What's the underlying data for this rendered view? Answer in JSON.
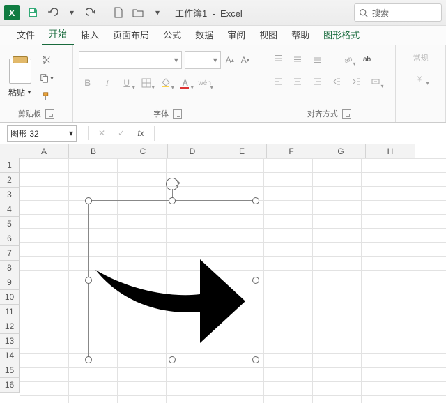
{
  "title": {
    "doc": "工作簿1",
    "app": "Excel"
  },
  "qat": {
    "save": "保存",
    "undo": "撤消",
    "redo": "恢复",
    "new": "新建",
    "open": "打开"
  },
  "search": {
    "placeholder": "搜索"
  },
  "tabs": {
    "file": "文件",
    "home": "开始",
    "insert": "插入",
    "layout": "页面布局",
    "formulas": "公式",
    "data": "数据",
    "review": "审阅",
    "view": "视图",
    "help": "帮助",
    "shape_format": "图形格式"
  },
  "ribbon": {
    "clipboard": {
      "label": "剪贴板",
      "paste": "粘贴"
    },
    "font": {
      "label": "字体",
      "bold": "B",
      "italic": "I",
      "underline": "U",
      "wen": "wén"
    },
    "align": {
      "label": "对齐方式",
      "wrap": "ab"
    },
    "general": {
      "label": "常规"
    }
  },
  "namebox": {
    "value": "图形 32"
  },
  "columns": [
    "A",
    "B",
    "C",
    "D",
    "E",
    "F",
    "G",
    "H"
  ],
  "rows": [
    "1",
    "2",
    "3",
    "4",
    "5",
    "6",
    "7",
    "8",
    "9",
    "10",
    "11",
    "12",
    "13",
    "14",
    "15",
    "16"
  ]
}
